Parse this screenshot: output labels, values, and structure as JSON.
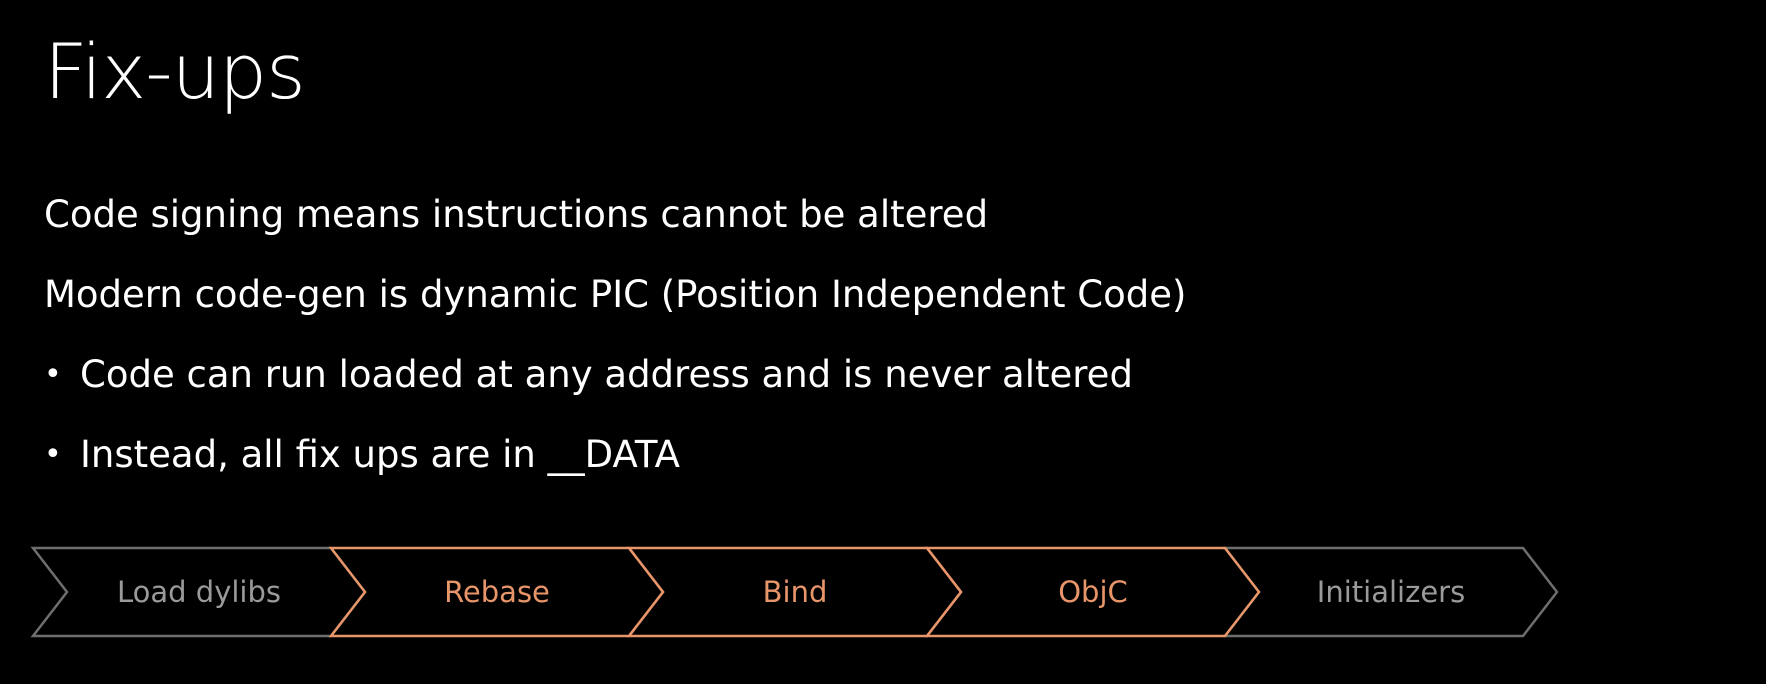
{
  "slide": {
    "title": "Fix-ups",
    "lines": [
      "Code signing means instructions cannot be altered",
      "Modern code-gen is dynamic PIC (Position Independent Code)"
    ],
    "bullets": [
      "Code can run loaded at any address and is never altered",
      "Instead, all fix ups are in __DATA"
    ],
    "bullet_char": "•"
  },
  "pipeline": {
    "stages": [
      {
        "label": "Load dylibs",
        "active": false
      },
      {
        "label": "Rebase",
        "active": true
      },
      {
        "label": "Bind",
        "active": true
      },
      {
        "label": "ObjC",
        "active": true
      },
      {
        "label": "Initializers",
        "active": false
      }
    ],
    "colors": {
      "active": "#e8956a",
      "inactive_text": "#9a9a9a",
      "inactive_stroke": "#6e6e6e"
    }
  }
}
